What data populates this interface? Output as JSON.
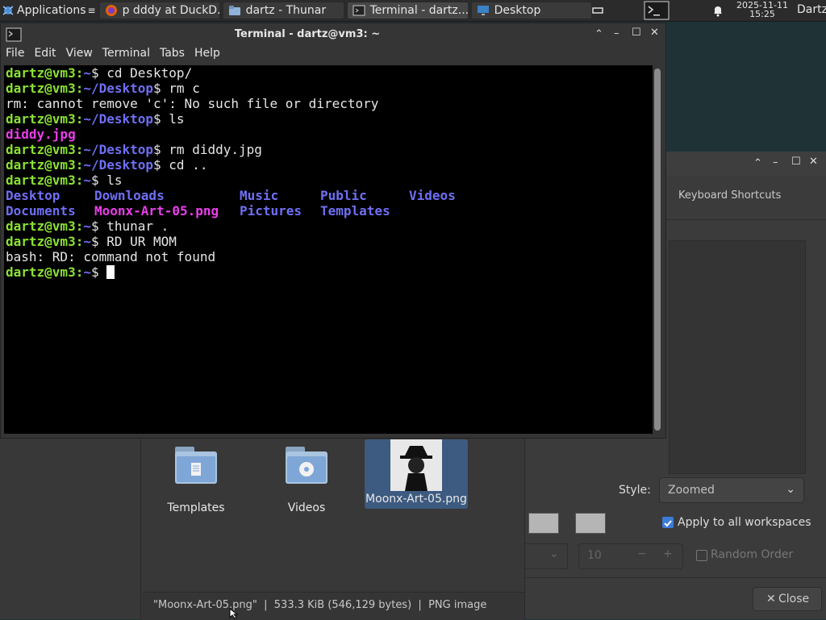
{
  "panel": {
    "applications_label": "Applications",
    "tasks": [
      {
        "label": "p dddy at DuckD..."
      },
      {
        "label": "dartz - Thunar"
      },
      {
        "label": "Terminal - dartz..."
      },
      {
        "label": "Desktop"
      }
    ],
    "clock_date": "2025-11-11",
    "clock_time": "15:25",
    "user": "Dartz"
  },
  "terminal": {
    "title": "Terminal - dartz@vm3: ~",
    "menu": [
      "File",
      "Edit",
      "View",
      "Terminal",
      "Tabs",
      "Help"
    ],
    "lines": [
      {
        "prompt": "dartz@vm3:",
        "path": "~",
        "cmd": "$ cd Desktop/"
      },
      {
        "prompt": "dartz@vm3:",
        "path": "~/Desktop",
        "cmd": "$ rm c"
      },
      {
        "output": "rm: cannot remove 'c': No such file or directory"
      },
      {
        "prompt": "dartz@vm3:",
        "path": "~/Desktop",
        "cmd": "$ ls"
      },
      {
        "file_magenta": "diddy.jpg"
      },
      {
        "prompt": "dartz@vm3:",
        "path": "~/Desktop",
        "cmd": "$ rm diddy.jpg"
      },
      {
        "prompt": "dartz@vm3:",
        "path": "~/Desktop",
        "cmd": "$ cd .."
      },
      {
        "prompt": "dartz@vm3:",
        "path": "~",
        "cmd": "$ ls"
      }
    ],
    "ls_row1": [
      "Desktop",
      "Downloads",
      "Music",
      "Public",
      "Videos"
    ],
    "ls_row2": [
      {
        "name": "Documents",
        "color": "blue"
      },
      {
        "name": "Moonx-Art-05.png",
        "color": "magenta"
      },
      {
        "name": "Pictures",
        "color": "blue"
      },
      {
        "name": "Templates",
        "color": "blue"
      }
    ],
    "after": [
      {
        "prompt": "dartz@vm3:",
        "path": "~",
        "cmd": "$ thunar ."
      },
      {
        "prompt": "dartz@vm3:",
        "path": "~",
        "cmd": "$ RD UR MOM"
      },
      {
        "output": "bash: RD: command not found"
      },
      {
        "prompt": "dartz@vm3:",
        "path": "~",
        "cmd": "$ "
      }
    ]
  },
  "thunar": {
    "items": [
      {
        "label": "Templates"
      },
      {
        "label": "Videos"
      },
      {
        "label": "Moonx-Art-05.png"
      }
    ],
    "status": "\"Moonx-Art-05.png\"  |  533.3 KiB (546,129 bytes)  |  PNG image"
  },
  "settings": {
    "tab_keyboard": "Keyboard Shortcuts",
    "style_label": "Style:",
    "style_value": "Zoomed",
    "apply_all_label": "Apply to all workspaces",
    "apply_all_checked": true,
    "spin_value": "10",
    "random_order_label": "Random Order",
    "close_label": "Close"
  },
  "colors": {
    "prompt_green": "#8ae234",
    "dir_blue": "#6f6ff5",
    "image_magenta": "#e93ee9",
    "selection_blue": "#3d5a80",
    "checkbox_blue": "#3d7bd9"
  }
}
